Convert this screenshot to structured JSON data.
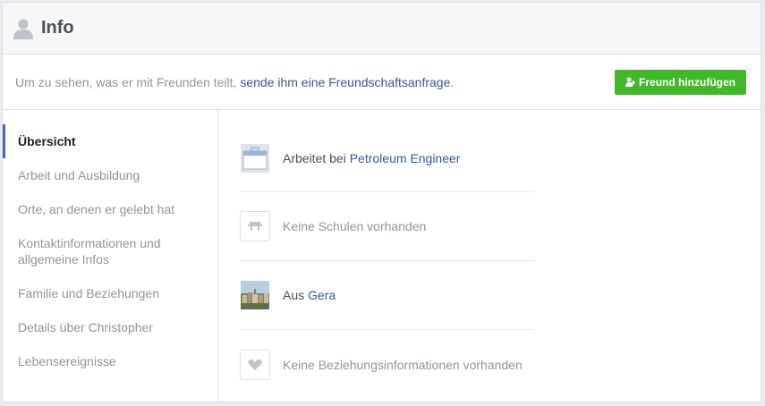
{
  "header": {
    "title": "Info",
    "icon": "person-silhouette-icon"
  },
  "notice": {
    "text_before": "Um zu sehen, was er mit Freunden teilt, ",
    "link": "sende ihm eine Freundschaftsanfrage",
    "text_after": ".",
    "button_label": "Freund hinzufügen",
    "button_icon": "add-friend-icon",
    "button_color": "#42b72a"
  },
  "sidebar": {
    "items": [
      {
        "label": "Übersicht",
        "active": true
      },
      {
        "label": "Arbeit und Ausbildung"
      },
      {
        "label": "Orte, an denen er gelebt hat"
      },
      {
        "label": "Kontaktinformationen und allgemeine Infos"
      },
      {
        "label": "Familie und Beziehungen"
      },
      {
        "label": "Details über Christopher"
      },
      {
        "label": "Lebensereignisse"
      }
    ]
  },
  "overview": {
    "work": {
      "prefix": "Arbeitet bei ",
      "link": "Petroleum Engineer",
      "icon": "work-briefcase-icon"
    },
    "school": {
      "text": "Keine Schulen vorhanden",
      "icon": "school-icon"
    },
    "hometown": {
      "prefix": "Aus ",
      "link": "Gera",
      "icon": "city-photo-icon"
    },
    "relationship": {
      "text": "Keine Beziehungsinformationen vorhanden",
      "icon": "heart-icon"
    }
  },
  "colors": {
    "link": "#365899",
    "active_indicator": "#4267b2"
  }
}
